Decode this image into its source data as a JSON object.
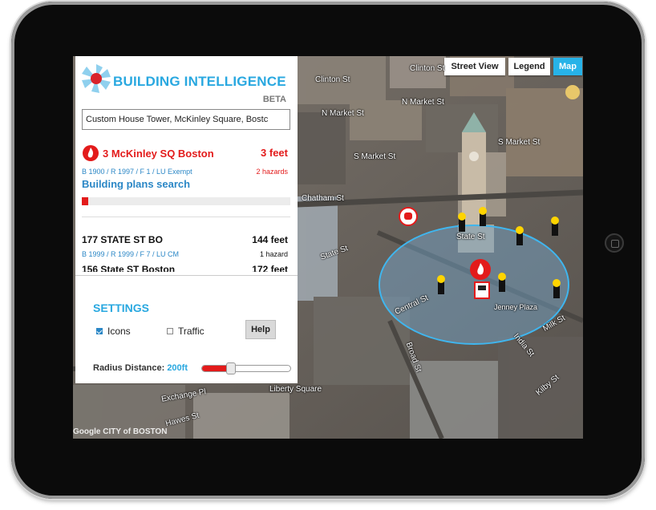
{
  "app": {
    "title": "BUILDING INTELLIGENCE",
    "badge": "BETA",
    "accent_color": "#29a8e0",
    "alert_color": "#e31b1b"
  },
  "search": {
    "value": "Custom House Tower, McKinley Square, Bostc"
  },
  "selected": {
    "address": "3 McKinley SQ Boston",
    "distance": "3 feet",
    "meta": "B 1900 / R 1997 / F 1 / LU Exempt",
    "hazards": "2 hazards",
    "plans_link": "Building plans search",
    "icon": "fire-icon",
    "progress": 0.03
  },
  "results": [
    {
      "address": "177 STATE ST BO",
      "distance": "144 feet",
      "meta": "B 1999 / R 1999 / F 7 / LU CM",
      "hazards": "1 hazard"
    },
    {
      "address": "156 State ST Boston",
      "distance": "172 feet",
      "meta": "",
      "hazards": ""
    }
  ],
  "settings": {
    "title": "SETTINGS",
    "icons_label": "Icons",
    "icons_checked": true,
    "traffic_label": "Traffic",
    "traffic_checked": false,
    "help_label": "Help",
    "radius_label": "Radius Distance:",
    "radius_value": "200ft",
    "radius_fraction": 0.33
  },
  "map": {
    "buttons": {
      "street_view": "Street View",
      "legend": "Legend",
      "map": "Map"
    },
    "active_button": "map",
    "street_labels": {
      "clinton_st_1": "Clinton St",
      "clinton_st_2": "Clinton St",
      "n_market_st_1": "N Market St",
      "n_market_st_2": "N Market St",
      "s_market_st_1": "S Market St",
      "s_market_st_2": "S Market St",
      "chatham_st": "Chatham St",
      "state_st_1": "State St",
      "state_st_2": "State St",
      "central_st": "Central St",
      "broad_st": "Broad St",
      "india_st": "India St",
      "milk_st": "Milk St",
      "kilby_st": "Kilby St",
      "exchange_pl": "Exchange Pl",
      "liberty_square": "Liberty Square",
      "hawes_st": "Hawes St",
      "jenney_plaza": "Jenney Plaza"
    },
    "watermark": "Google CITY of BOSTON",
    "radius_circle_color": "#3fb6ef",
    "hydrant_color": "#ffd400",
    "icons": [
      "fire-station-icon",
      "gas-mask-icon",
      "electrical-panel-icon",
      "hydrant-icon"
    ]
  }
}
